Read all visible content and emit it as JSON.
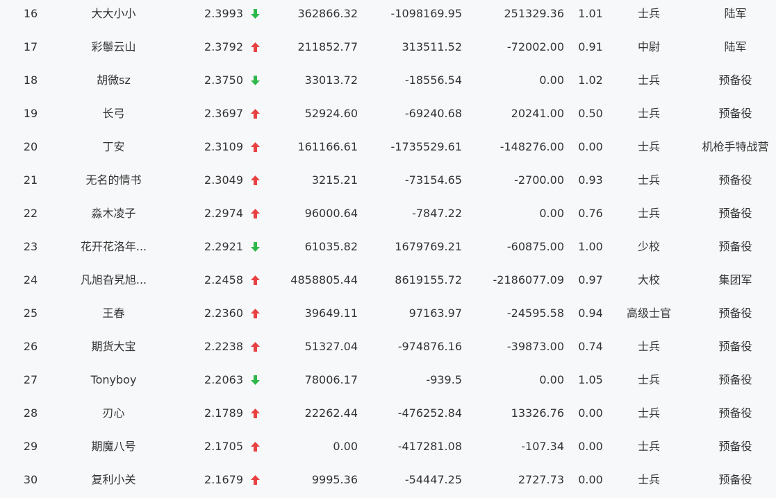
{
  "colors": {
    "up": "#e84142",
    "down": "#2fb84a",
    "text": "#333333",
    "background": "#f7f8fa"
  },
  "rows": [
    {
      "rank": "16",
      "name": "大大小小",
      "score": "2.3993",
      "trend": "down",
      "trend_icon": "arrow-down-icon",
      "col1": "362866.32",
      "col2": "-1098169.95",
      "col3": "251329.36",
      "ratio": "1.01",
      "title": "士兵",
      "unit": "陆军"
    },
    {
      "rank": "17",
      "name": "彩鬡云山",
      "score": "2.3792",
      "trend": "up",
      "trend_icon": "arrow-up-icon",
      "col1": "211852.77",
      "col2": "313511.52",
      "col3": "-72002.00",
      "ratio": "0.91",
      "title": "中尉",
      "unit": "陆军"
    },
    {
      "rank": "18",
      "name": "胡微sz",
      "score": "2.3750",
      "trend": "down",
      "trend_icon": "arrow-down-icon",
      "col1": "33013.72",
      "col2": "-18556.54",
      "col3": "0.00",
      "ratio": "1.02",
      "title": "士兵",
      "unit": "预备役"
    },
    {
      "rank": "19",
      "name": "长弓",
      "score": "2.3697",
      "trend": "up",
      "trend_icon": "arrow-up-icon",
      "col1": "52924.60",
      "col2": "-69240.68",
      "col3": "20241.00",
      "ratio": "0.50",
      "title": "士兵",
      "unit": "预备役"
    },
    {
      "rank": "20",
      "name": "丁安",
      "score": "2.3109",
      "trend": "up",
      "trend_icon": "arrow-up-icon",
      "col1": "161166.61",
      "col2": "-1735529.61",
      "col3": "-148276.00",
      "ratio": "0.00",
      "title": "士兵",
      "unit": "机枪手特战营"
    },
    {
      "rank": "21",
      "name": "无名的情书",
      "score": "2.3049",
      "trend": "up",
      "trend_icon": "arrow-up-icon",
      "col1": "3215.21",
      "col2": "-73154.65",
      "col3": "-2700.00",
      "ratio": "0.93",
      "title": "士兵",
      "unit": "预备役"
    },
    {
      "rank": "22",
      "name": "淼木凌子",
      "score": "2.2974",
      "trend": "up",
      "trend_icon": "arrow-up-icon",
      "col1": "96000.64",
      "col2": "-7847.22",
      "col3": "0.00",
      "ratio": "0.76",
      "title": "士兵",
      "unit": "预备役"
    },
    {
      "rank": "23",
      "name": "花开花洛年...",
      "score": "2.2921",
      "trend": "down",
      "trend_icon": "arrow-down-icon",
      "col1": "61035.82",
      "col2": "1679769.21",
      "col3": "-60875.00",
      "ratio": "1.00",
      "title": "少校",
      "unit": "预备役"
    },
    {
      "rank": "24",
      "name": "凡旭旮旯旭...",
      "score": "2.2458",
      "trend": "up",
      "trend_icon": "arrow-up-icon",
      "col1": "4858805.44",
      "col2": "8619155.72",
      "col3": "-2186077.09",
      "ratio": "0.97",
      "title": "大校",
      "unit": "集团军"
    },
    {
      "rank": "25",
      "name": "王春",
      "score": "2.2360",
      "trend": "up",
      "trend_icon": "arrow-up-icon",
      "col1": "39649.11",
      "col2": "97163.97",
      "col3": "-24595.58",
      "ratio": "0.94",
      "title": "高级士官",
      "unit": "预备役"
    },
    {
      "rank": "26",
      "name": "期货大宝",
      "score": "2.2238",
      "trend": "up",
      "trend_icon": "arrow-up-icon",
      "col1": "51327.04",
      "col2": "-974876.16",
      "col3": "-39873.00",
      "ratio": "0.74",
      "title": "士兵",
      "unit": "预备役"
    },
    {
      "rank": "27",
      "name": "Tonyboy",
      "score": "2.2063",
      "trend": "down",
      "trend_icon": "arrow-down-icon",
      "col1": "78006.17",
      "col2": "-939.5",
      "col3": "0.00",
      "ratio": "1.05",
      "title": "士兵",
      "unit": "预备役"
    },
    {
      "rank": "28",
      "name": "刃心",
      "score": "2.1789",
      "trend": "up",
      "trend_icon": "arrow-up-icon",
      "col1": "22262.44",
      "col2": "-476252.84",
      "col3": "13326.76",
      "ratio": "0.00",
      "title": "士兵",
      "unit": "预备役"
    },
    {
      "rank": "29",
      "name": "期魔八号",
      "score": "2.1705",
      "trend": "up",
      "trend_icon": "arrow-up-icon",
      "col1": "0.00",
      "col2": "-417281.08",
      "col3": "-107.34",
      "ratio": "0.00",
      "title": "士兵",
      "unit": "预备役"
    },
    {
      "rank": "30",
      "name": "复利小关",
      "score": "2.1679",
      "trend": "up",
      "trend_icon": "arrow-up-icon",
      "col1": "9995.36",
      "col2": "-54447.25",
      "col3": "2727.73",
      "ratio": "0.00",
      "title": "士兵",
      "unit": "预备役"
    }
  ]
}
